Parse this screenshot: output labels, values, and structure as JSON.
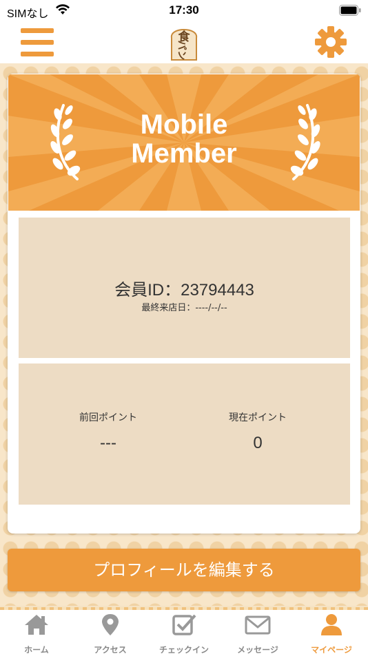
{
  "status_bar": {
    "carrier": "SIMなし",
    "time": "17:30"
  },
  "header": {
    "menu_icon": "hamburger-menu-icon",
    "logo_text": "食パン",
    "settings_icon": "gear-icon"
  },
  "banner": {
    "title_line1": "Mobile",
    "title_line2": "Member"
  },
  "member": {
    "id_text": "会員ID：23794443",
    "last_visit": "最終来店日：----/--/--"
  },
  "points": {
    "previous_label": "前回ポイント",
    "previous_value": "---",
    "current_label": "現在ポイント",
    "current_value": "0"
  },
  "profile_button": "プロフィールを編集する",
  "tabs": [
    {
      "label": "ホーム",
      "icon": "home-icon",
      "active": false
    },
    {
      "label": "アクセス",
      "icon": "map-pin-icon",
      "active": false
    },
    {
      "label": "チェックイン",
      "icon": "checkbox-icon",
      "active": false
    },
    {
      "label": "メッセージ",
      "icon": "envelope-icon",
      "active": false
    },
    {
      "label": "マイページ",
      "icon": "user-icon",
      "active": true
    }
  ],
  "colors": {
    "accent": "#ee9a3c",
    "panel": "#eddcc4",
    "background": "#f8e6c9",
    "tab_inactive": "#888888"
  }
}
